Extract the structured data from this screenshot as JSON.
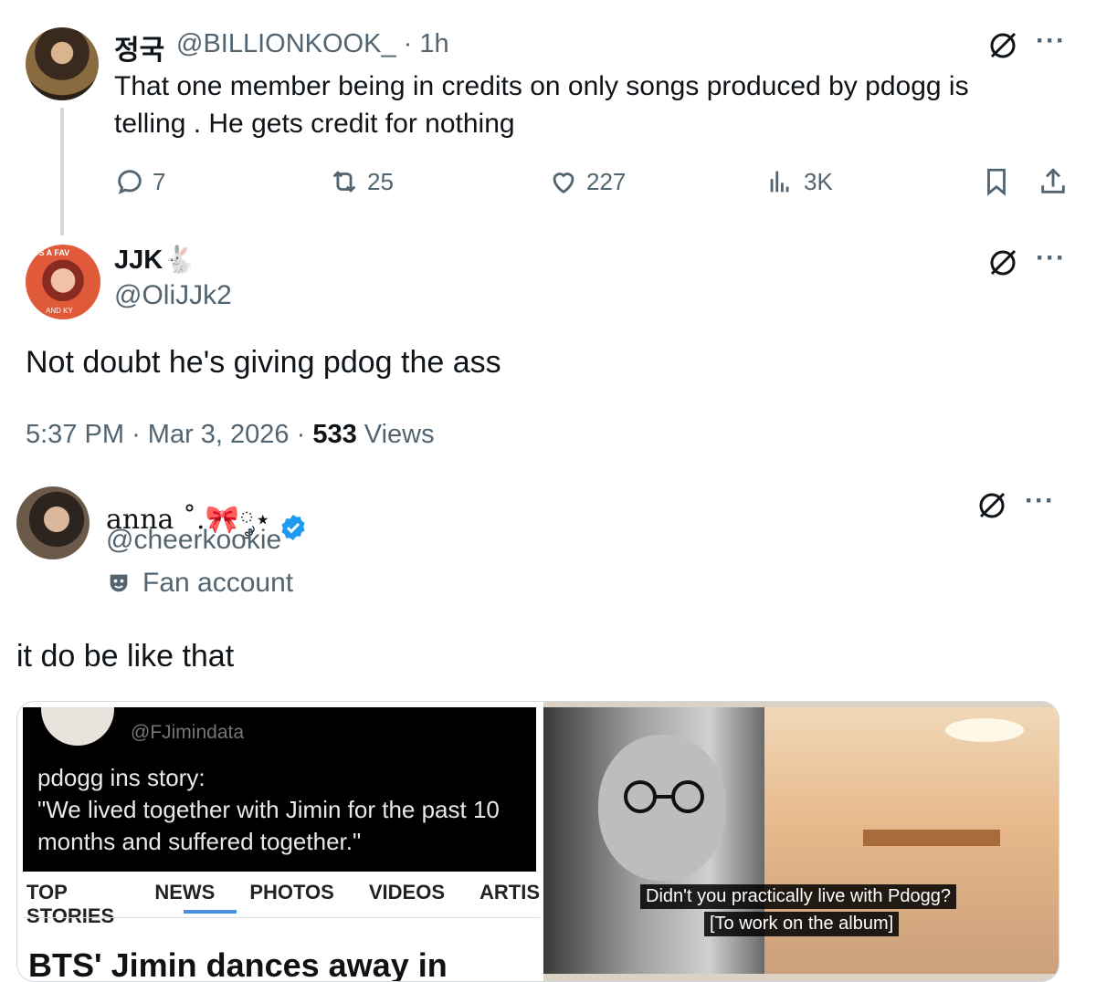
{
  "reply_parent": {
    "display_name": "정국",
    "handle": "@BILLIONKOOK_",
    "time": "1h",
    "text": "That one member being in credits on only songs produced by pdogg is telling . He gets credit for nothing",
    "actions": {
      "replies": "7",
      "reposts": "25",
      "likes": "227",
      "views": "3K"
    }
  },
  "main_tweet": {
    "display_name": "JJK",
    "name_emoji": "🐇",
    "handle": "@OliJJk2",
    "text": "Not doubt he's giving pdog the ass",
    "time": "5:37 PM",
    "date": "Mar 3, 2026",
    "views_count": "533",
    "views_label": "Views",
    "avatar_text_top": "US A FAV",
    "avatar_text_bottom": "AND KY"
  },
  "reply": {
    "display_name": "anna ˚.🎀༘⋆",
    "handle": "@cheerkookie",
    "label": "Fan account",
    "text": "it do be like that",
    "verified_color": "#1d9bf0"
  },
  "media": {
    "left": {
      "handle": "@FJimindata",
      "story_text": "pdogg ins story:\n\"We lived together with Jimin for the past 10 months and suffered together.\"",
      "tabs": [
        "TOP STORIES",
        "NEWS",
        "PHOTOS",
        "VIDEOS",
        "ARTIS"
      ],
      "headline": "BTS' Jimin dances away in"
    },
    "right": {
      "subtitle_line1": "Didn't you practically live with Pdogg?",
      "subtitle_line2": "[To work on the album]"
    }
  },
  "icons": {
    "grok": "grok-icon",
    "more": "more-icon"
  }
}
